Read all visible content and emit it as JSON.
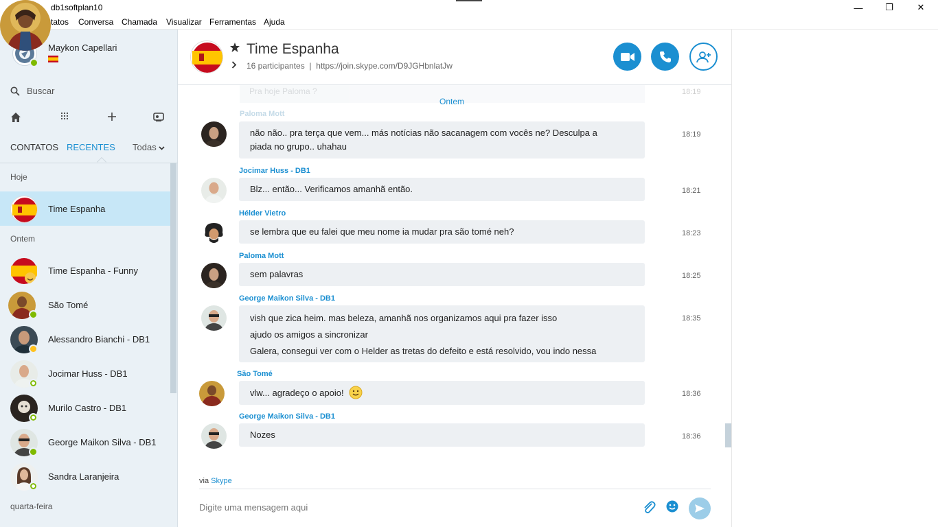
{
  "window": {
    "title": "db1softplan10",
    "controls": {
      "minimize": "—",
      "maximize": "❐",
      "close": "✕"
    }
  },
  "menu": [
    "tatos",
    "Conversa",
    "Chamada",
    "Visualizar",
    "Ferramentas",
    "Ajuda"
  ],
  "me": {
    "name": "Maykon Capellari"
  },
  "sidebar": {
    "search_label": "Buscar",
    "tabs": {
      "contacts": "CONTATOS",
      "recent": "RECENTES",
      "filter": "Todas"
    },
    "sections": {
      "today": "Hoje",
      "yesterday": "Ontem",
      "wednesday": "quarta-feira"
    },
    "items": [
      {
        "name": "Time Espanha"
      },
      {
        "name": "Time Espanha - Funny"
      },
      {
        "name": "São Tomé"
      },
      {
        "name": "Alessandro Bianchi - DB1"
      },
      {
        "name": "Jocimar Huss - DB1"
      },
      {
        "name": "Murilo Castro - DB1"
      },
      {
        "name": "George Maikon Silva - DB1"
      },
      {
        "name": "Sandra Laranjeira"
      }
    ]
  },
  "header": {
    "title": "Time Espanha",
    "participants": "16 participantes",
    "separator": "|",
    "link": "https://join.skype.com/D9JGHbnlatJw"
  },
  "chat": {
    "faded_text": "Pra hoje Paloma ?",
    "faded_time": "18:19",
    "faded_author": "Paloma Mott",
    "day_label": "Ontem",
    "messages": [
      {
        "author": "",
        "lines": [
          "não não.. pra terça que vem... más notícias não sacanagem com vocês ne? Desculpa a",
          "piada no grupo.. uhahau"
        ],
        "time": "18:19"
      },
      {
        "author": "Jocimar Huss - DB1",
        "lines": [
          "Blz... então... Verificamos amanhã então."
        ],
        "time": "18:21"
      },
      {
        "author": "Hélder Vietro",
        "lines": [
          "se lembra que eu falei que meu nome ia mudar pra são tomé neh?"
        ],
        "time": "18:23"
      },
      {
        "author": "Paloma Mott",
        "lines": [
          "sem palavras"
        ],
        "time": "18:25"
      },
      {
        "author": "George Maikon Silva - DB1",
        "lines": [
          "vish que zica heim. mas beleza, amanhã nos organizamos aqui pra fazer isso",
          "ajudo os amigos a sincronizar",
          "Galera, consegui ver com o Helder as tretas do defeito e está resolvido, vou indo nessa"
        ],
        "time": "18:35"
      },
      {
        "author": "São Tomé",
        "lines": [
          "vlw... agradeço o apoio!"
        ],
        "time": "18:36"
      },
      {
        "author": "George Maikon Silva - DB1",
        "lines": [
          "Nozes"
        ],
        "time": "18:36"
      }
    ]
  },
  "footer": {
    "via": "via",
    "via_link": "Skype",
    "placeholder": "Digite uma mensagem aqui"
  },
  "colors": {
    "accent": "#1b8fd1",
    "sidebar_bg": "#eaf1f6",
    "active_bg": "#c7e7f7",
    "bubble_bg": "#edf0f3"
  }
}
